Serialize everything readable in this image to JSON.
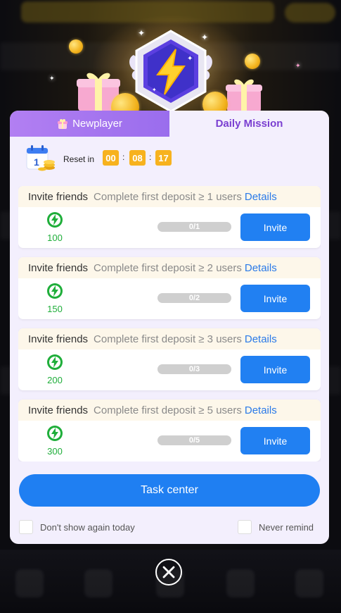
{
  "tabs": {
    "newplayer": "Newplayer",
    "daily": "Daily Mission"
  },
  "reset": {
    "label": "Reset in",
    "hours": "00",
    "minutes": "08",
    "seconds": "17",
    "separator": ":"
  },
  "tasks": [
    {
      "title": "Invite friends",
      "desc": "Complete first deposit ≥ 1 users",
      "details": "Details",
      "reward": "100",
      "progress": "0/1",
      "action": "Invite"
    },
    {
      "title": "Invite friends",
      "desc": "Complete first deposit ≥ 2 users",
      "details": "Details",
      "reward": "150",
      "progress": "0/2",
      "action": "Invite"
    },
    {
      "title": "Invite friends",
      "desc": "Complete first deposit ≥ 3 users",
      "details": "Details",
      "reward": "200",
      "progress": "0/3",
      "action": "Invite"
    },
    {
      "title": "Invite friends",
      "desc": "Complete first deposit ≥ 5 users",
      "details": "Details",
      "reward": "300",
      "progress": "0/5",
      "action": "Invite"
    }
  ],
  "task_center_label": "Task center",
  "options": {
    "dont_show_today": "Don't show again today",
    "never_remind": "Never remind"
  },
  "icons": {
    "badge": "lightning-badge-icon",
    "reward": "lightning-circle-icon",
    "calendar": "calendar-coins-icon",
    "close": "close-circle-icon",
    "gift": "gift-icon"
  },
  "colors": {
    "accent_purple": "#9a6ded",
    "primary_blue": "#2180f2",
    "reward_green": "#1fae3a",
    "timer_orange": "#f7b21e",
    "details_blue": "#2a7ae8"
  }
}
